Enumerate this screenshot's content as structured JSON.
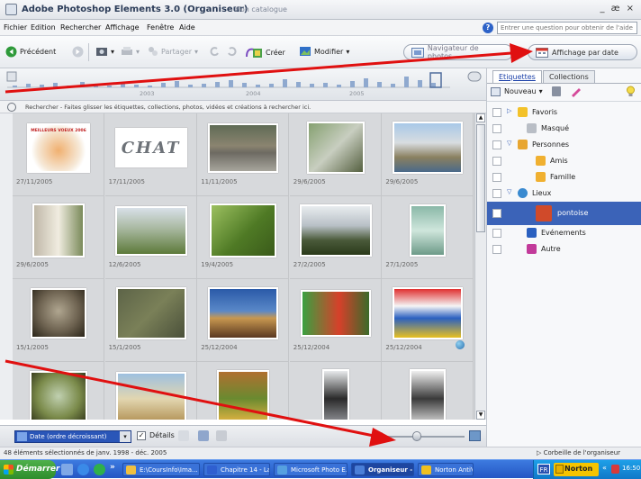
{
  "window": {
    "title": "Adobe Photoshop Elements 3.0 (Organiseur)",
    "catalog": "Mon catalogue",
    "controls": "_ æ ×"
  },
  "menu": {
    "items": [
      "Fichier",
      "Edition",
      "Rechercher",
      "Affichage",
      "Fenêtre",
      "Aide"
    ],
    "help_placeholder": "Entrer une question pour obtenir de l'aide"
  },
  "toolbar": {
    "back": "Précédent",
    "share": "Partager",
    "create": "Créer",
    "modify": "Modifier",
    "photo_browser": "Navigateur de photos",
    "date_view": "Affichage par date"
  },
  "timeline": {
    "years": [
      "2003",
      "2004",
      "2005"
    ]
  },
  "search_hint": "Rechercher - Faites glisser les étiquettes, collections, photos, vidéos et créations à rechercher ici.",
  "photos": [
    {
      "date": "27/11/2005",
      "label": "MEILLEURS VOEUX 2006",
      "kind": "card"
    },
    {
      "date": "17/11/2005",
      "label": "CHAT",
      "kind": "text"
    },
    {
      "date": "11/11/2005",
      "kind": "car"
    },
    {
      "date": "29/6/2005",
      "kind": "gull"
    },
    {
      "date": "29/6/2005",
      "kind": "harbor"
    },
    {
      "date": "29/6/2005",
      "kind": "street"
    },
    {
      "date": "12/6/2005",
      "kind": "valley"
    },
    {
      "date": "19/4/2005",
      "kind": "trees"
    },
    {
      "date": "27/2/2005",
      "kind": "bridge"
    },
    {
      "date": "27/1/2005",
      "kind": "glass"
    },
    {
      "date": "15/1/2005",
      "kind": "cat"
    },
    {
      "date": "15/1/2005",
      "kind": "texture"
    },
    {
      "date": "25/12/2004",
      "kind": "castle"
    },
    {
      "date": "25/12/2004",
      "kind": "cans"
    },
    {
      "date": "25/12/2004",
      "kind": "pencils"
    },
    {
      "date": "",
      "kind": "cat2"
    },
    {
      "date": "",
      "kind": "pyramid"
    },
    {
      "date": "",
      "kind": "tree"
    },
    {
      "date": "",
      "kind": "person"
    },
    {
      "date": "",
      "kind": "bwphoto"
    }
  ],
  "bottombar": {
    "sort": "Date (ordre décroissant)",
    "details": "Détails"
  },
  "panel": {
    "tabs": [
      "Etiquettes",
      "Collections"
    ],
    "new_label": "Nouveau",
    "tags": [
      {
        "label": "Favoris",
        "level": 0,
        "icon": "star",
        "expand": "▷"
      },
      {
        "label": "Masqué",
        "level": 1,
        "icon": "hidden",
        "expand": ""
      },
      {
        "label": "Personnes",
        "level": 0,
        "icon": "people",
        "expand": "▽"
      },
      {
        "label": "Amis",
        "level": 2,
        "icon": "folder",
        "expand": ""
      },
      {
        "label": "Famille",
        "level": 2,
        "icon": "folder",
        "expand": ""
      },
      {
        "label": "Lieux",
        "level": 0,
        "icon": "globe",
        "expand": "▽"
      },
      {
        "label": "pontoise",
        "level": 2,
        "icon": "photo",
        "expand": "",
        "selected": true
      },
      {
        "label": "Evénements",
        "level": 1,
        "icon": "event",
        "expand": ""
      },
      {
        "label": "Autre",
        "level": 1,
        "icon": "other",
        "expand": ""
      }
    ]
  },
  "status": {
    "left": "48 éléments sélectionnés de janv. 1998 - déc. 2005",
    "right": "Corbeille de l'organiseur"
  },
  "taskbar": {
    "start": "Démarrer",
    "tasks": [
      {
        "label": "E:\\CoursInfo\\Ima...",
        "color": "#f0c040"
      },
      {
        "label": "Chapitre 14 - La ...",
        "color": "#2f5fd0"
      },
      {
        "label": "Microsoft Photo E...",
        "color": "#56a0e0"
      },
      {
        "label": "Organiseur - Ph...",
        "color": "#4a7fd8",
        "active": true
      },
      {
        "label": "Norton AntiVirus",
        "color": "#f0c020"
      }
    ],
    "lang": "FR",
    "norton": "Norton",
    "time": "16:50"
  },
  "colors": {
    "arrow": "#e01010",
    "selection": "#3b63b8",
    "taskbar": "#2456c4"
  }
}
